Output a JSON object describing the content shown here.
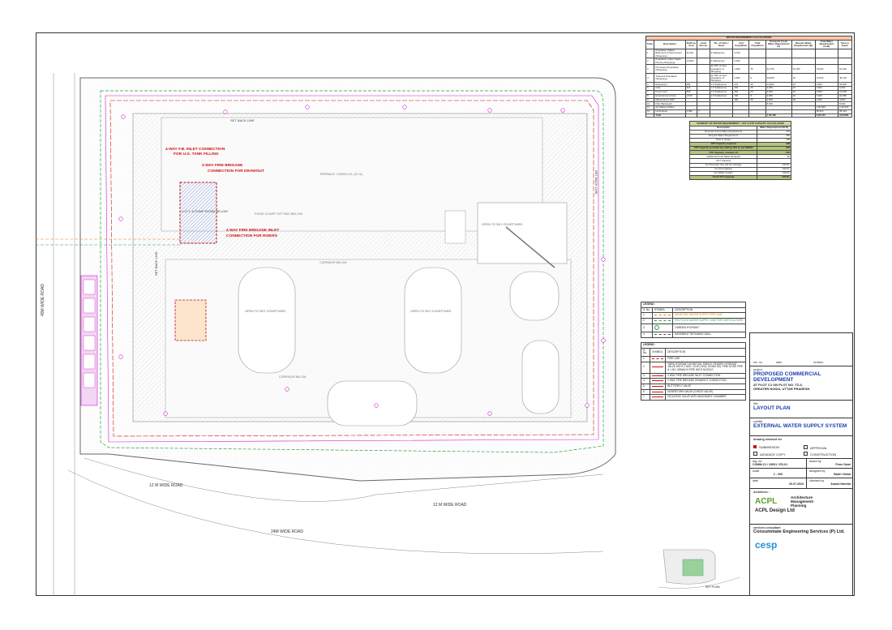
{
  "project": {
    "heading": "project",
    "title": "PROPOSED COMMERCIAL DEVELOPMENT",
    "line2": "AT PLOT C1 ON PLOT NO. TZ-6,",
    "line3": "GREATER NOIDA, UTTAR PRADESH"
  },
  "title_block": {
    "title_heading": "title",
    "title": "LAYOUT PLAN",
    "subtitle_heading": "subtitle",
    "subtitle": "EXTERNAL WATER SUPPLY SYSTEM",
    "drawing_released_for": "drawing released for",
    "options": [
      "SUBMISSION",
      "APPROVAL",
      "ADVANCE COPY",
      "CONSTRUCTION"
    ],
    "dwg_no_label": "drg. no.",
    "dwg_no": "COMM-C1 / 23001 / ES-01",
    "drawn_by_label": "drawn by",
    "drawn_by": "Prem Saini",
    "scale_label": "scale",
    "scale": "1 : 200",
    "designed_by_label": "designed by",
    "designed_by": "Badri Vishal",
    "date_label": "date",
    "date": "20.07.2023",
    "checked_by_label": "checked by",
    "checked_by": "Anand Havelia",
    "rev_headers": [
      "rev. no.",
      "date",
      "revision"
    ],
    "architects_label": "Architects :",
    "architect_logo": "ACPL",
    "architect_name": "ACPL Design Ltd",
    "architect_tag1": "Architecture",
    "architect_tag2": "Management",
    "architect_tag3": "Planning",
    "consultant_label": "services consultant",
    "consultant_name": "Consummate Engineering Services (P) Ltd.",
    "consultant_logo": "cesp"
  },
  "water_table": {
    "title": "WATER REQUIREMENT CALCULATIONS",
    "headers": [
      "S.No.",
      "Description",
      "Built up Area",
      "Area/ Person",
      "No. of Units / Seats",
      "Unit Population",
      "Total Population",
      "Domestic Fresh Water Requirement (A)",
      "Recycle Water Requirement (B)",
      "Total Water Requirement (A+B)",
      "Flow to Sewer"
    ],
    "rows": [
      [
        "1",
        "Population (Sales/ Basement & Street Floor) (Shopping)",
        "11,542",
        "",
        "3 Sqft/person",
        "3,700",
        "",
        "",
        "",
        "",
        ""
      ],
      [
        "2",
        "Population (Upper Sales Floors) (Shopping)",
        "14,800",
        "",
        "6 Sqft/person",
        "2,450",
        "",
        "",
        "",
        "",
        ""
      ],
      [
        "3",
        "Permanent Population (Shopping)",
        "",
        "",
        "@ 20% of total population of Shopping",
        "1,849",
        "35",
        "64,735",
        "51,200",
        "70,000",
        "51,200"
      ],
      [
        "4",
        "Transient Population (Shopping)",
        "",
        "",
        "@ 75% of total population of Shopping",
        "4,965",
        "5",
        "24,825",
        "10",
        "72,000",
        "48,720"
      ],
      [
        "5",
        "Restaurant",
        "480",
        "",
        "1.6 Sqft/person",
        "270",
        "35",
        "14,850",
        "15",
        "4,050",
        "18,900"
      ],
      [
        "6",
        "Cafe",
        "316",
        "",
        "1.6 Sqft/person",
        "160",
        "25",
        "4,000",
        "10",
        "1,600",
        "5,600"
      ],
      [
        "7",
        "Food Court",
        "636",
        "",
        "1.6 Sqft/person",
        "360",
        "25",
        "9,000",
        "10",
        "3,600",
        "12,600"
      ],
      [
        "8",
        "Entertainment Zone",
        "1,515",
        "",
        "1.6 Sqft/person",
        "730",
        "5",
        "3,650",
        "10",
        "7,300",
        "10,950"
      ],
      [
        "9",
        "Maintenance Staff",
        "",
        "",
        "",
        "100",
        "25",
        "2,500",
        "20",
        "2,000",
        "4,500"
      ],
      [
        "10",
        "Filter Backwash",
        "",
        "",
        "",
        "",
        "",
        "8,000",
        "",
        "",
        "8,000"
      ],
      [
        "11",
        "AC Makeup Water",
        "",
        "",
        "",
        "",
        "",
        "",
        "",
        "1,30,000",
        "1,30,000"
      ],
      [
        "12",
        "Horticulture",
        "4,090",
        "7",
        "",
        "",
        "",
        "",
        "",
        "28,413",
        "28,413"
      ],
      [
        "",
        "Total",
        "",
        "",
        "",
        "",
        "",
        "1,32,360",
        "",
        "2,96,163",
        "3,63,883"
      ]
    ]
  },
  "stp_table": {
    "title": "SUMMARY OF WATER REQUIREMENT - UGT & STP CAPACITY CALCULATION",
    "col1": "Description",
    "col2": "Water Requirement (KLD)",
    "rows": [
      [
        "Domestic Fresh Water Requirement",
        "133"
      ],
      [
        "Recycle Water Requirement",
        "280"
      ],
      [
        "Flow to Sewer",
        "198"
      ],
      [
        "STP Capacity required",
        "198"
      ],
      [
        "STP Capacity provided (by adding 10% as per MOEF)",
        "218"
      ],
      [
        "STP Capacity rounded off",
        "220"
      ],
      [
        "Additional Fresh Water Required",
        "80"
      ],
      [
        "UGT Capacity",
        ""
      ],
      [
        "For Domestic Use (24 hrs storage)",
        "133 KL"
      ],
      [
        "For Fire Fighting",
        "150 KL"
      ],
      [
        "For Water Curtain",
        "140 KL"
      ],
      [
        "Total UGT Capacity",
        "590 KL"
      ]
    ]
  },
  "legend1": {
    "title": "LEGEND :",
    "headers": [
      "S. No.",
      "SYMBOL",
      "DESCRIPTION"
    ],
    "items": [
      {
        "no": "1",
        "desc": "MUNICIPAL WATER SUPPLY PIPE LINE"
      },
      {
        "no": "2",
        "desc": "RECYCLED WATER SUPPLY LINE FOR HORTICULTURE"
      },
      {
        "no": "3",
        "desc": "GARDEN HYDRANT"
      },
      {
        "no": "4",
        "desc": "BASEMENT RETAINING WALL"
      }
    ]
  },
  "legend2": {
    "title": "LEGEND :",
    "headers": [
      "S. No.",
      "SYMBOL",
      "DESCRIPTION"
    ],
    "items": [
      {
        "no": "1",
        "desc": "FIRE LINE"
      },
      {
        "no": "2",
        "desc": "YARD HYDRANT 63 MM DIA. SINGLE HEADED HYDRANT VALVE WITH 2 NOS. 15 M LONG, 63 MM DIA. FIRE HOSE PIPE & 1 NO. BRANCH PIPE WITH NOZZLE"
      },
      {
        "no": "3",
        "desc": "4 WAY FIRE BRIGADE INLET CONNECTION"
      },
      {
        "no": "4",
        "desc": "2 WAY FIRE BRIGADE DRAWOUT CONNECTION"
      },
      {
        "no": "5",
        "desc": "BUTTERFLY VALVE"
      },
      {
        "no": "6",
        "desc": "NONRETURN VALVE (CHECK VALVE)"
      },
      {
        "no": "7",
        "desc": "ISOLATING VALVE WITH MASONARY CHAMBER"
      }
    ]
  },
  "plan": {
    "roads": [
      "12 M WIDE ROAD",
      "12 M WIDE ROAD",
      "24M WIDE ROAD",
      "45M WIDE ROAD"
    ],
    "setback": "SET BACK LINE",
    "callouts_red": [
      "4-WAY F.B. INLET CONNECTION FOR U.G. TANK FILLING",
      "2-WAY FIRE BRIGADE CONNECTION FOR DRAWOUT",
      "4 WAY FIRE BRIGADE INLET CONNECTION FOR RISERS"
    ],
    "ugt_label": "U.G.T. & PUMP ROOM BELOW",
    "terrace_label": "TERRACE +24000 LVL (G+4)",
    "courtyard_label": "OPEN TO SKY COURTYARD",
    "corridor_label": "CORRIDOR BELOW",
    "food_court": "FOOD COURT SITTING BELOW",
    "key_plan": "KEY PLAN"
  }
}
